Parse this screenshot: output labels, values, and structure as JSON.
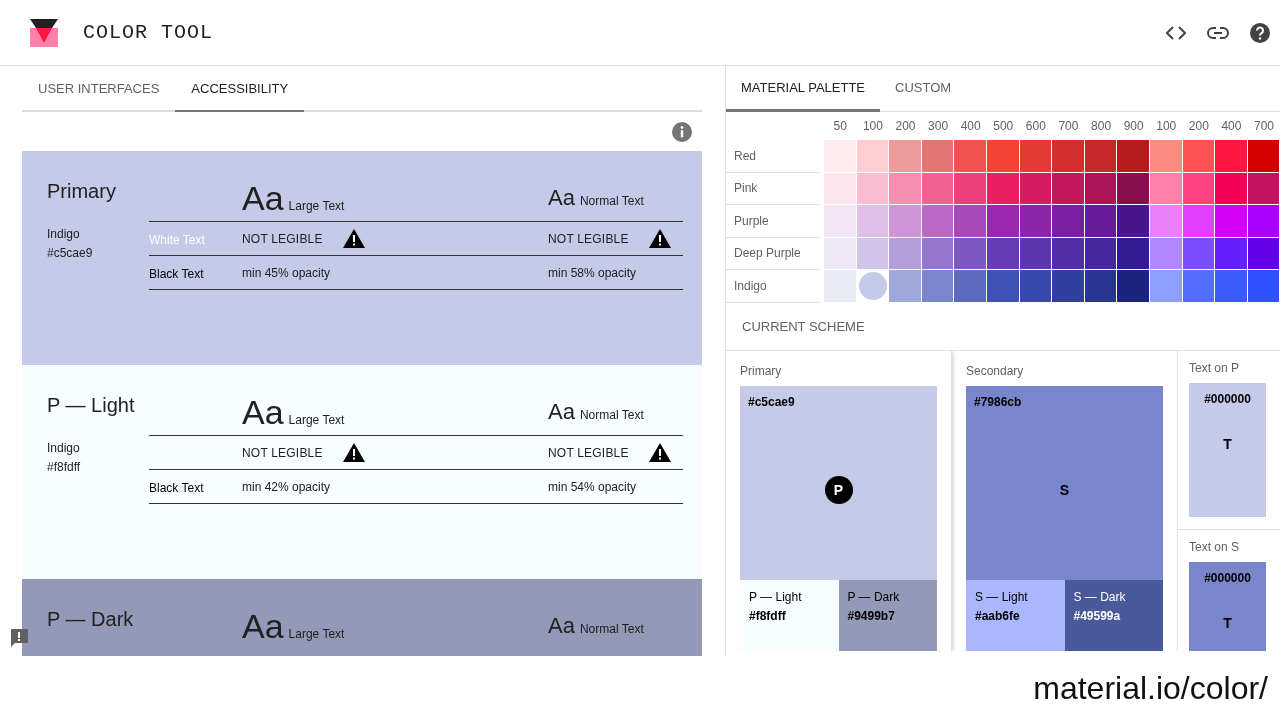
{
  "app": {
    "title": "COLOR TOOL"
  },
  "left_tabs": [
    {
      "label": "USER INTERFACES",
      "selected": false
    },
    {
      "label": "ACCESSIBILITY",
      "selected": true
    }
  ],
  "accessibility_cards": [
    {
      "name": "Primary",
      "palette": "Indigo",
      "hex": "#c5cae9",
      "color": "#c5cae9",
      "large_sample": "Aa",
      "normal_sample": "Aa",
      "large_label": "Large Text",
      "normal_label": "Normal Text",
      "rows": [
        {
          "label": "White Text",
          "color": "#ffffff",
          "large": {
            "text": "NOT LEGIBLE",
            "warning": true
          },
          "normal": {
            "text": "NOT LEGIBLE",
            "warning": true
          }
        },
        {
          "label": "Black Text",
          "color": "#000000",
          "large": {
            "text": "min 45% opacity",
            "warning": false
          },
          "normal": {
            "text": "min 58% opacity",
            "warning": false
          }
        }
      ]
    },
    {
      "name": "P — Light",
      "palette": "Indigo",
      "hex": "#f8fdff",
      "color": "#f8fdff",
      "large_sample": "Aa",
      "normal_sample": "Aa",
      "large_label": "Large Text",
      "normal_label": "Normal Text",
      "rows": [
        {
          "large": {
            "text": "NOT LEGIBLE",
            "warning": true
          },
          "normal": {
            "text": "NOT LEGIBLE",
            "warning": true
          }
        },
        {
          "label": "Black Text",
          "color": "#000000",
          "large": {
            "text": "min 42% opacity",
            "warning": false
          },
          "normal": {
            "text": "min 54% opacity",
            "warning": false
          }
        }
      ]
    },
    {
      "name": "P — Dark",
      "color": "#9499b7",
      "large_sample": "Aa",
      "normal_sample": "Aa",
      "large_label": "Large Text",
      "normal_label": "Normal Text"
    }
  ],
  "palette_tabs": [
    {
      "label": "MATERIAL PALETTE",
      "selected": true
    },
    {
      "label": "CUSTOM",
      "selected": false
    }
  ],
  "shades": [
    "50",
    "100",
    "200",
    "300",
    "400",
    "500",
    "600",
    "700",
    "800",
    "900",
    "100",
    "200",
    "400",
    "700"
  ],
  "palette_rows": [
    {
      "name": "Red",
      "cells": [
        {
          "color": "#ffebee",
          "selected": false
        },
        {
          "color": "#ffcdd2",
          "selected": false
        },
        {
          "color": "#ef9a9a",
          "selected": false
        },
        {
          "color": "#e57373",
          "selected": false
        },
        {
          "color": "#ef5350",
          "selected": false
        },
        {
          "color": "#f44336",
          "selected": false
        },
        {
          "color": "#e53935",
          "selected": false
        },
        {
          "color": "#d32f2f",
          "selected": false
        },
        {
          "color": "#c62828",
          "selected": false
        },
        {
          "color": "#b71c1c",
          "selected": false
        },
        {
          "color": "#ff8a80",
          "selected": false
        },
        {
          "color": "#ff5252",
          "selected": false
        },
        {
          "color": "#ff1744",
          "selected": false
        },
        {
          "color": "#d50000",
          "selected": false
        }
      ]
    },
    {
      "name": "Pink",
      "cells": [
        {
          "color": "#fce4ec",
          "selected": false
        },
        {
          "color": "#f8bbd0",
          "selected": false
        },
        {
          "color": "#f48fb1",
          "selected": false
        },
        {
          "color": "#f06292",
          "selected": false
        },
        {
          "color": "#ec407a",
          "selected": false
        },
        {
          "color": "#e91e63",
          "selected": false
        },
        {
          "color": "#d81b60",
          "selected": false
        },
        {
          "color": "#c2185b",
          "selected": false
        },
        {
          "color": "#ad1457",
          "selected": false
        },
        {
          "color": "#880e4f",
          "selected": false
        },
        {
          "color": "#ff80ab",
          "selected": false
        },
        {
          "color": "#ff4081",
          "selected": false
        },
        {
          "color": "#f50057",
          "selected": false
        },
        {
          "color": "#c51162",
          "selected": false
        }
      ]
    },
    {
      "name": "Purple",
      "cells": [
        {
          "color": "#f3e5f5",
          "selected": false
        },
        {
          "color": "#e1bee7",
          "selected": false
        },
        {
          "color": "#ce93d8",
          "selected": false
        },
        {
          "color": "#ba68c8",
          "selected": false
        },
        {
          "color": "#ab47bc",
          "selected": false
        },
        {
          "color": "#9c27b0",
          "selected": false
        },
        {
          "color": "#8e24aa",
          "selected": false
        },
        {
          "color": "#7b1fa2",
          "selected": false
        },
        {
          "color": "#6a1b9a",
          "selected": false
        },
        {
          "color": "#4a148c",
          "selected": false
        },
        {
          "color": "#ea80fc",
          "selected": false
        },
        {
          "color": "#e040fb",
          "selected": false
        },
        {
          "color": "#d500f9",
          "selected": false
        },
        {
          "color": "#aa00ff",
          "selected": false
        }
      ]
    },
    {
      "name": "Deep Purple",
      "cells": [
        {
          "color": "#ede7f6",
          "selected": false
        },
        {
          "color": "#d1c4e9",
          "selected": false
        },
        {
          "color": "#b39ddb",
          "selected": false
        },
        {
          "color": "#9575cd",
          "selected": false
        },
        {
          "color": "#7e57c2",
          "selected": false
        },
        {
          "color": "#673ab7",
          "selected": false
        },
        {
          "color": "#5e35b1",
          "selected": false
        },
        {
          "color": "#512da8",
          "selected": false
        },
        {
          "color": "#4527a0",
          "selected": false
        },
        {
          "color": "#311b92",
          "selected": false
        },
        {
          "color": "#b388ff",
          "selected": false
        },
        {
          "color": "#7c4dff",
          "selected": false
        },
        {
          "color": "#651fff",
          "selected": false
        },
        {
          "color": "#6200ea",
          "selected": false
        }
      ]
    },
    {
      "name": "Indigo",
      "cells": [
        {
          "color": "#e8eaf6",
          "selected": false
        },
        {
          "color": "#c5cae9",
          "selected": true
        },
        {
          "color": "#9fa8da",
          "selected": false
        },
        {
          "color": "#7986cb",
          "selected": false
        },
        {
          "color": "#5c6bc0",
          "selected": false
        },
        {
          "color": "#3f51b5",
          "selected": false
        },
        {
          "color": "#3949ab",
          "selected": false
        },
        {
          "color": "#303f9f",
          "selected": false
        },
        {
          "color": "#283593",
          "selected": false
        },
        {
          "color": "#1a237e",
          "selected": false
        },
        {
          "color": "#8c9eff",
          "selected": false
        },
        {
          "color": "#536dfe",
          "selected": false
        },
        {
          "color": "#3d5afe",
          "selected": false
        },
        {
          "color": "#304ffe",
          "selected": false
        }
      ]
    }
  ],
  "scheme_title": "CURRENT SCHEME",
  "scheme_cards": [
    {
      "title": "Primary",
      "selected": true,
      "main": {
        "hex": "#c5cae9",
        "color": "#c5cae9",
        "letter": "P"
      },
      "light": {
        "label": "P — Light",
        "hex": "#f8fdff",
        "color": "#f8fdff"
      },
      "dark": {
        "label": "P — Dark",
        "hex": "#9499b7",
        "color": "#9499b7"
      }
    },
    {
      "title": "Secondary",
      "selected": false,
      "main": {
        "hex": "#7986cb",
        "color": "#7986cb",
        "letter": "S"
      },
      "light": {
        "label": "S — Light",
        "hex": "#aab6fe",
        "color": "#aab6fe"
      },
      "dark": {
        "label": "S — Dark",
        "hex": "#49599a",
        "color": "#49599a"
      }
    }
  ],
  "text_cards": [
    {
      "title": "Text on P",
      "color": "#c5cae9",
      "hex": "#000000",
      "letter": "T"
    },
    {
      "title": "Text on S",
      "color": "#7986cb",
      "hex": "#000000",
      "letter": "T"
    }
  ],
  "caption": "material.io/color/"
}
